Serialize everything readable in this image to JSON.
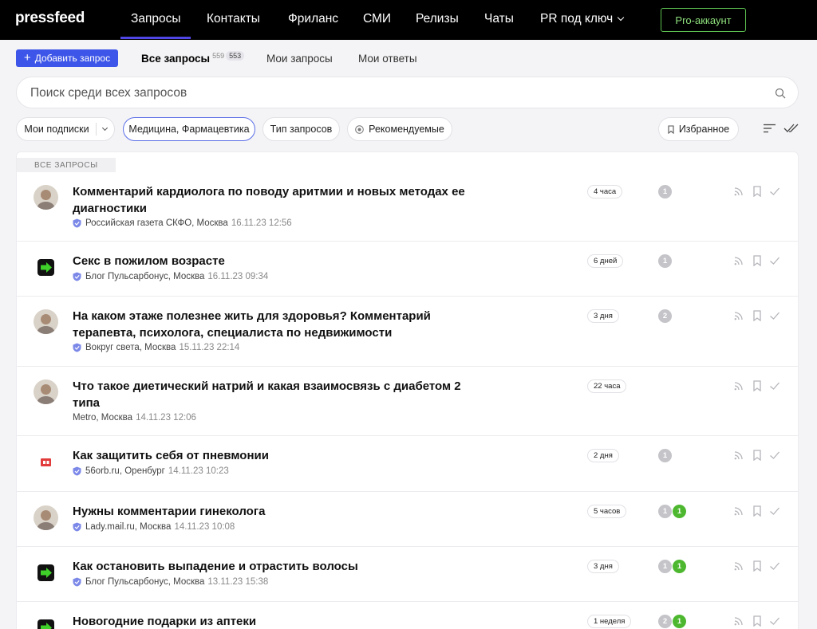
{
  "nav": {
    "logo": "pressfeed",
    "items": [
      {
        "label": "Запросы"
      },
      {
        "label": "Контакты"
      },
      {
        "label": "Фриланс"
      },
      {
        "label": "СМИ"
      },
      {
        "label": "Релизы"
      },
      {
        "label": "Чаты"
      },
      {
        "label": "PR под ключ"
      }
    ],
    "pro_button": "Pro-аккаунт",
    "colors": {
      "bg": "#000000",
      "active_underline": "#4f46e5",
      "pro": "#5cc04f"
    }
  },
  "subnav": {
    "add_button": "Добавить запрос",
    "tabs": [
      {
        "label": "Все запросы",
        "count": "559",
        "badge": "553"
      },
      {
        "label": "Мои запросы"
      },
      {
        "label": "Мои ответы"
      }
    ]
  },
  "search": {
    "placeholder": "Поиск среди всех запросов"
  },
  "filters": {
    "subscriptions": "Мои подписки",
    "category": "Медицина, Фармацевтика",
    "type": "Тип запросов",
    "recommended": "Рекомендуемые",
    "favorites": "Избранное"
  },
  "list": {
    "section_label": "ВСЕ ЗАПРОСЫ",
    "items": [
      {
        "title": "Комментарий кардиолога по поводу аритмии и новых методах ее диагностики",
        "source": "Российская газета СКФО, Москва",
        "date": "16.11.23 12:56",
        "age": "4 часа",
        "counts": [
          "1"
        ],
        "verified": true,
        "avatar": "person"
      },
      {
        "title": "Секс в пожилом возрасте",
        "source": "Блог Пульсарбонус, Москва",
        "date": "16.11.23 09:34",
        "age": "6 дней",
        "counts": [
          "1"
        ],
        "verified": true,
        "avatar": "green-arrow"
      },
      {
        "title": "На каком этаже полезнее жить для здоровья? Комментарий терапевта, психолога, специалиста по недвижимости",
        "source": "Вокруг света, Москва",
        "date": "15.11.23 22:14",
        "age": "3 дня",
        "counts": [
          "2"
        ],
        "verified": true,
        "avatar": "person"
      },
      {
        "title": "Что такое диетический натрий и какая взаимосвязь с диабетом 2 типа",
        "source": "Metro, Москва",
        "date": "14.11.23 12:06",
        "age": "22 часа",
        "counts": [],
        "verified": false,
        "avatar": "person"
      },
      {
        "title": "Как защитить себя от пневмонии",
        "source": "56orb.ru, Оренбург",
        "date": "14.11.23 10:23",
        "age": "2 дня",
        "counts": [
          "1"
        ],
        "verified": true,
        "avatar": "red-logo"
      },
      {
        "title": "Нужны комментарии гинеколога",
        "source": "Lady.mail.ru, Москва",
        "date": "14.11.23 10:08",
        "age": "5 часов",
        "counts": [
          "1",
          "1"
        ],
        "verified": true,
        "avatar": "person"
      },
      {
        "title": "Как остановить выпадение и отрастить волосы",
        "source": "Блог Пульсарбонус, Москва",
        "date": "13.11.23 15:38",
        "age": "3 дня",
        "counts": [
          "1",
          "1"
        ],
        "verified": true,
        "avatar": "green-arrow"
      },
      {
        "title": "Новогодние подарки из аптеки",
        "source": "",
        "date": "",
        "age": "1 неделя",
        "counts": [
          "2",
          "1"
        ],
        "verified": false,
        "avatar": "green-arrow"
      }
    ]
  }
}
